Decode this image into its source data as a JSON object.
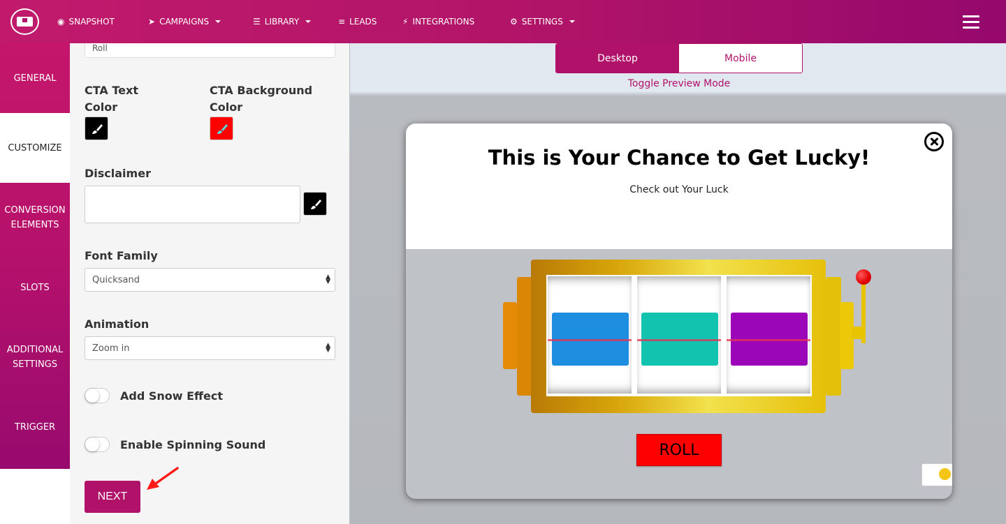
{
  "nav": {
    "items": [
      {
        "label": "SNAPSHOT",
        "icon": "dashboard-icon",
        "caret": false
      },
      {
        "label": "CAMPAIGNS",
        "icon": "paper-plane-icon",
        "caret": true
      },
      {
        "label": "LIBRARY",
        "icon": "library-icon",
        "caret": true
      },
      {
        "label": "LEADS",
        "icon": "list-icon",
        "caret": false
      },
      {
        "label": "INTEGRATIONS",
        "icon": "plug-icon",
        "caret": false
      },
      {
        "label": "SETTINGS",
        "icon": "gears-icon",
        "caret": true
      }
    ],
    "menu_icon": "hamburger-icon"
  },
  "steps": [
    {
      "label": "GENERAL",
      "active": false
    },
    {
      "label": "CUSTOMIZE",
      "active": true
    },
    {
      "label": "CONVERSION ELEMENTS",
      "active": false
    },
    {
      "label": "SLOTS",
      "active": false
    },
    {
      "label": "ADDITIONAL SETTINGS",
      "active": false
    },
    {
      "label": "TRIGGER",
      "active": false
    }
  ],
  "panel": {
    "cta_text_value": "Roll",
    "cta_text_color_label": "CTA Text Color",
    "cta_bg_color_label": "CTA Background Color",
    "cta_text_color": "#000000",
    "cta_bg_color": "#ff0000",
    "disclaimer_label": "Disclaimer",
    "disclaimer_value": "",
    "disclaimer_color": "#000000",
    "font_family_label": "Font Family",
    "font_family_value": "Quicksand",
    "animation_label": "Animation",
    "animation_value": "Zoom in",
    "snow_label": "Add Snow Effect",
    "snow_on": false,
    "sound_label": "Enable Spinning Sound",
    "sound_on": false,
    "next_label": "NEXT"
  },
  "preview": {
    "mode_desktop": "Desktop",
    "mode_mobile": "Mobile",
    "active_mode": "Desktop",
    "toggle_caption": "Toggle Preview Mode",
    "popup": {
      "title": "This is Your Chance to Get Lucky!",
      "subtitle": "Check out Your Luck",
      "reel_colors": [
        "#1e8fe0",
        "#12c4b0",
        "#9b06b8"
      ],
      "roll_label": "ROLL"
    }
  },
  "colors": {
    "brand": "#b0126a",
    "accent_red": "#ff0000"
  }
}
